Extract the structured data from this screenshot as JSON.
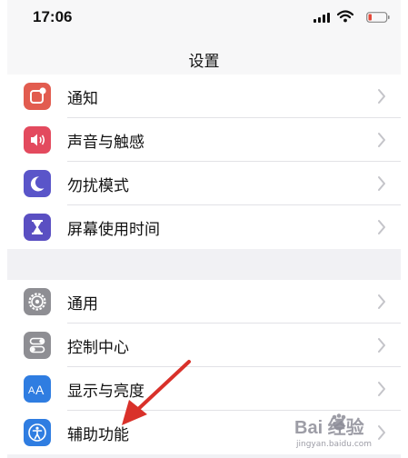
{
  "status_bar": {
    "time": "17:06",
    "icons": [
      "cellular-signal-icon",
      "wifi-icon",
      "battery-icon"
    ],
    "battery_color": "#e5493a"
  },
  "nav": {
    "title": "设置"
  },
  "groups": [
    {
      "items": [
        {
          "label": "通知",
          "icon": "notification-icon",
          "color": "#e25c4f"
        },
        {
          "label": "声音与触感",
          "icon": "speaker-icon",
          "color": "#e34a5e"
        },
        {
          "label": "勿扰模式",
          "icon": "moon-icon",
          "color": "#5a55c9"
        },
        {
          "label": "屏幕使用时间",
          "icon": "hourglass-icon",
          "color": "#5a4fc2"
        }
      ]
    },
    {
      "items": [
        {
          "label": "通用",
          "icon": "gear-icon",
          "color": "#8e8e93"
        },
        {
          "label": "控制中心",
          "icon": "toggle-switches-icon",
          "color": "#8e8e93"
        },
        {
          "label": "显示与亮度",
          "icon": "text-size-aa-icon",
          "color": "#2f7de1"
        },
        {
          "label": "辅助功能",
          "icon": "accessibility-icon",
          "color": "#2f7de1"
        }
      ]
    }
  ],
  "annotation": {
    "arrow_color": "#d9312a"
  },
  "watermark": {
    "text": "Bai 经验",
    "sub": "jingyan.baidu.com"
  }
}
